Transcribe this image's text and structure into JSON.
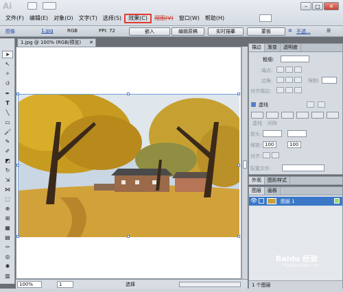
{
  "app": {
    "logo": "Ai",
    "window_controls": [
      "–",
      "□",
      "✕"
    ]
  },
  "menu": {
    "items": [
      "文件(F)",
      "编辑(E)",
      "对象(O)",
      "文字(T)",
      "选择(S)",
      "效果(C)",
      "视图(V)",
      "窗口(W)",
      "帮助(H)"
    ],
    "highlighted_index": 5,
    "highlight_color": "#e23a2e"
  },
  "control_bar": {
    "selection_type": "图像",
    "link_name": "1.jpg",
    "color_mode": "RGB",
    "ppi": "PPI: 72",
    "embed_button": "嵌入",
    "edit_original_button": "编辑原稿",
    "live_trace_button": "实时描摹",
    "mask_button": "蒙板",
    "opacity_label": "不透..."
  },
  "document": {
    "tab_title": "1.jpg @ 100% (RGB/预览)",
    "zoom": "100%",
    "page": "1",
    "status": "选择"
  },
  "stroke_panel": {
    "tabs": [
      "描边",
      "渐变",
      "透明度"
    ],
    "weight_label": "粗细:",
    "cap_label": "端点:",
    "corner_label": "边角:",
    "limit_label": "限制:",
    "align_label": "对齐描边:",
    "dashed_label": "虚线",
    "dash_label": "虚线",
    "gap_label": "间隙",
    "arrowheads_label": "箭头:",
    "scale_label": "缩放:",
    "scale_start": "100",
    "scale_end": "100",
    "align_arrows_label": "对齐:",
    "profile_label": "配置文件:"
  },
  "appearance_panel": {
    "tabs": [
      "外观",
      "图形样式"
    ]
  },
  "layers_panel": {
    "tabs": [
      "图层",
      "画板"
    ],
    "layer_name": "图层 1",
    "footer": "1 个图层",
    "selection_color": "#3b78c8"
  },
  "watermark": {
    "text": "Baidu 经验",
    "url": "jingyan.baidu.com"
  }
}
